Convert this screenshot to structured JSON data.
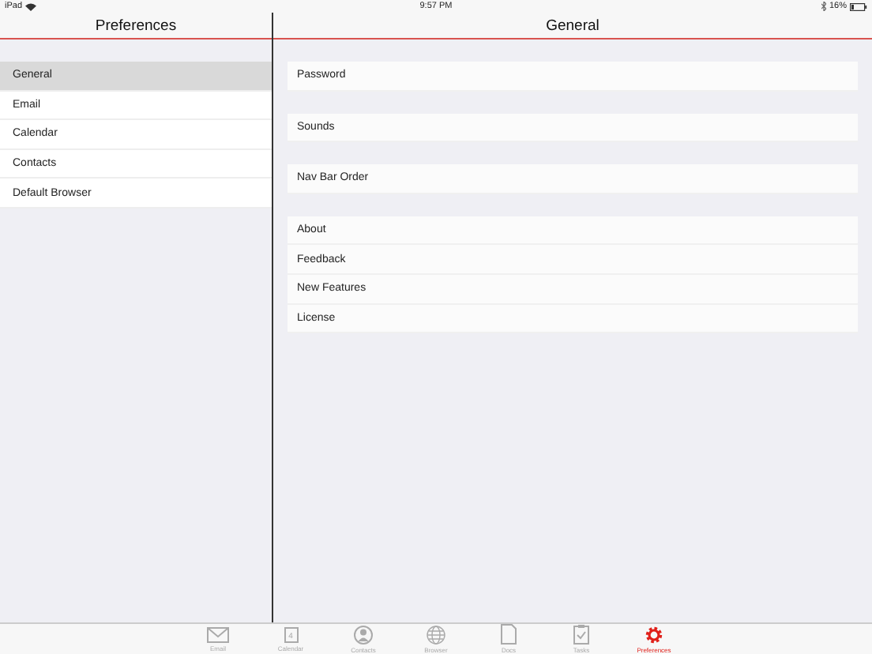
{
  "status_bar": {
    "device": "iPad",
    "time": "9:57 PM",
    "battery": "16%"
  },
  "sidebar": {
    "title": "Preferences",
    "items": [
      {
        "label": "General",
        "selected": true
      },
      {
        "label": "Email",
        "selected": false
      },
      {
        "label": "Calendar",
        "selected": false
      },
      {
        "label": "Contacts",
        "selected": false
      },
      {
        "label": "Default Browser",
        "selected": false
      }
    ]
  },
  "detail": {
    "title": "General",
    "groups": [
      [
        "Password"
      ],
      [
        "Sounds"
      ],
      [
        "Nav Bar Order"
      ],
      [
        "About",
        "Feedback",
        "New Features",
        "License"
      ]
    ]
  },
  "tab_bar": [
    {
      "kind": "mail",
      "label": "Email",
      "selected": false
    },
    {
      "kind": "calendar",
      "label": "Calendar",
      "badge": "4",
      "selected": false
    },
    {
      "kind": "person",
      "label": "Contacts",
      "selected": false
    },
    {
      "kind": "globe",
      "label": "Browser",
      "selected": false
    },
    {
      "kind": "doc",
      "label": "Docs",
      "selected": false
    },
    {
      "kind": "clipboard",
      "label": "Tasks",
      "selected": false
    },
    {
      "kind": "gear",
      "label": "Preferences",
      "selected": true
    }
  ]
}
